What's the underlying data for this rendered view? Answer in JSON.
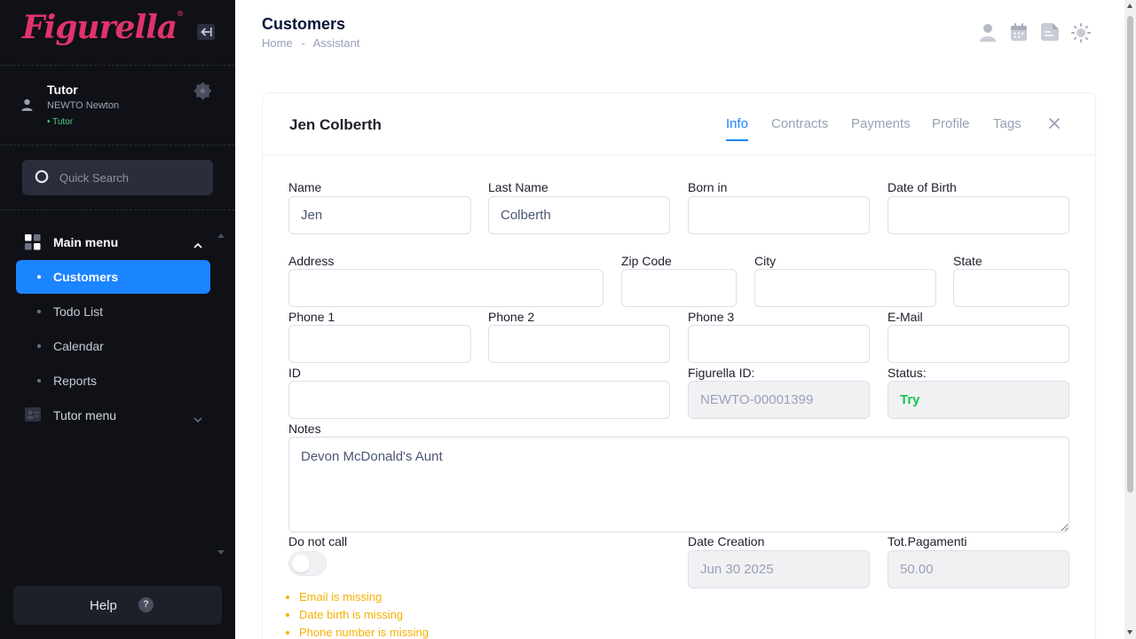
{
  "brand": {
    "logo_text": "Figurella",
    "logo_mark": "®",
    "color": "#e0336b"
  },
  "sidebar": {
    "user": {
      "name": "Tutor",
      "sub": "NEWTO Newton",
      "role": "Tutor"
    },
    "search": {
      "placeholder": "Quick Search"
    },
    "main_menu": {
      "label": "Main menu",
      "items": [
        {
          "label": "Customers",
          "active": true
        },
        {
          "label": "Todo List",
          "active": false
        },
        {
          "label": "Calendar",
          "active": false
        },
        {
          "label": "Reports",
          "active": false
        }
      ]
    },
    "tutor_menu": {
      "label": "Tutor menu"
    },
    "help": {
      "label": "Help",
      "icon_text": "?"
    }
  },
  "header": {
    "title": "Customers",
    "breadcrumb": [
      "Home",
      "-",
      "Assistant"
    ],
    "icons": [
      "user-icon",
      "calendar-icon",
      "document-icon",
      "sun-icon"
    ]
  },
  "customer": {
    "name": "Jen Colberth",
    "tabs": [
      "Info",
      "Contracts",
      "Payments",
      "Profile",
      "Tags"
    ],
    "active_tab": "Info",
    "fields": {
      "name": {
        "label": "Name",
        "value": "Jen"
      },
      "last_name": {
        "label": "Last Name",
        "value": "Colberth"
      },
      "born_in": {
        "label": "Born in",
        "value": ""
      },
      "dob": {
        "label": "Date of Birth",
        "value": ""
      },
      "address": {
        "label": "Address",
        "value": ""
      },
      "zip": {
        "label": "Zip Code",
        "value": ""
      },
      "city": {
        "label": "City",
        "value": ""
      },
      "state": {
        "label": "State",
        "value": ""
      },
      "phone1": {
        "label": "Phone 1",
        "value": ""
      },
      "phone2": {
        "label": "Phone 2",
        "value": ""
      },
      "phone3": {
        "label": "Phone 3",
        "value": ""
      },
      "email": {
        "label": "E-Mail",
        "value": ""
      },
      "id": {
        "label": "ID",
        "value": ""
      },
      "figurella_id": {
        "label": "Figurella ID:",
        "value": "NEWTO-00001399"
      },
      "status": {
        "label": "Status:",
        "value": "Try"
      },
      "notes": {
        "label": "Notes",
        "value": "Devon McDonald's Aunt"
      },
      "do_not_call": {
        "label": "Do not call",
        "checked": false
      },
      "date_creation": {
        "label": "Date Creation",
        "value": "Jun 30 2025"
      },
      "tot_pagamenti": {
        "label": "Tot.Pagamenti",
        "value": "50.00"
      }
    },
    "warnings": [
      "Email is missing",
      "Date birth is missing",
      "Phone number is missing"
    ]
  },
  "colors": {
    "accent": "#1b84ff",
    "warning": "#f6b100",
    "success": "#17c653",
    "sidebar_bg": "#0f1117"
  }
}
